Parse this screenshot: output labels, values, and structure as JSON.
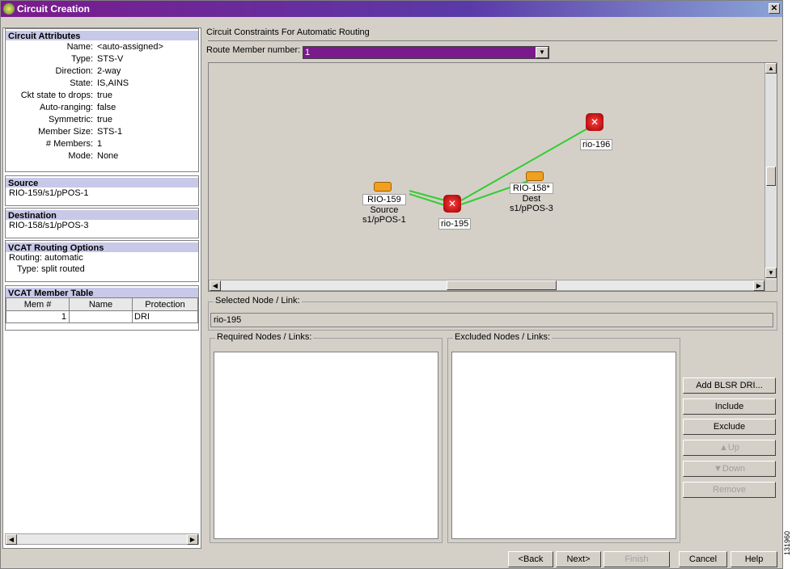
{
  "window": {
    "title": "Circuit Creation"
  },
  "circuit_attributes": {
    "header": "Circuit Attributes",
    "rows": [
      {
        "label": "Name:",
        "value": "<auto-assigned>"
      },
      {
        "label": "Type:",
        "value": "STS-V"
      },
      {
        "label": "Direction:",
        "value": "2-way"
      },
      {
        "label": "State:",
        "value": "IS,AINS"
      },
      {
        "label": "Ckt state to drops:",
        "value": "true"
      },
      {
        "label": "Auto-ranging:",
        "value": "false"
      },
      {
        "label": "Symmetric:",
        "value": "true"
      },
      {
        "label": "Member Size:",
        "value": "STS-1"
      },
      {
        "label": "# Members:",
        "value": "1"
      },
      {
        "label": "Mode:",
        "value": "None"
      }
    ]
  },
  "source": {
    "header": "Source",
    "value": "RIO-159/s1/pPOS-1"
  },
  "destination": {
    "header": "Destination",
    "value": "RIO-158/s1/pPOS-3"
  },
  "vcat_routing": {
    "header": "VCAT Routing Options",
    "routing": "Routing:  automatic",
    "type": "Type:  split routed"
  },
  "vcat_member_table": {
    "header": "VCAT Member Table",
    "columns": [
      "Mem #",
      "Name",
      "Protection"
    ],
    "rows": [
      [
        "1",
        "",
        "DRI"
      ]
    ]
  },
  "constraints": {
    "title": "Circuit Constraints For Automatic Routing",
    "route_member_label": "Route Member number:",
    "route_member_value": "1"
  },
  "graph": {
    "nodes": {
      "rio159": {
        "name": "RIO-159",
        "role": "Source",
        "port": "s1/pPOS-1"
      },
      "rio195": {
        "name": "rio-195"
      },
      "rio196": {
        "name": "rio-196"
      },
      "rio158": {
        "name": "RIO-158*",
        "role": "Dest",
        "port": "s1/pPOS-3"
      }
    },
    "link_color": "#33cc33"
  },
  "selected": {
    "label": "Selected Node / Link:",
    "value": "rio-195"
  },
  "required": {
    "label": "Required Nodes / Links:"
  },
  "excluded": {
    "label": "Excluded Nodes / Links:"
  },
  "side_buttons": {
    "add_blsr": "Add BLSR DRI...",
    "include": "Include",
    "exclude": "Exclude",
    "up": "▲Up",
    "down": "▼Down",
    "remove": "Remove"
  },
  "footer": {
    "back": "<Back",
    "next": "Next>",
    "finish": "Finish",
    "cancel": "Cancel",
    "help": "Help"
  },
  "figure_id": "131960"
}
